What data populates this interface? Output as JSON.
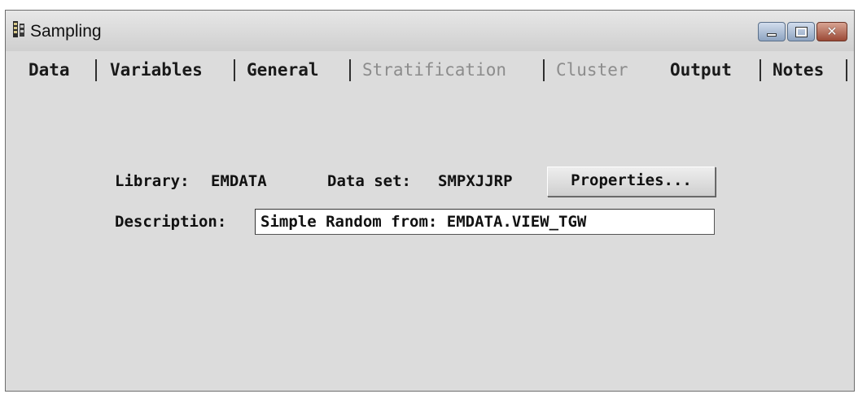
{
  "window": {
    "title": "Sampling"
  },
  "tabs": [
    {
      "label": "Data",
      "enabled": true
    },
    {
      "label": "Variables",
      "enabled": true
    },
    {
      "label": "General",
      "enabled": true
    },
    {
      "label": "Stratification",
      "enabled": false
    },
    {
      "label": "Cluster",
      "enabled": false
    },
    {
      "label": "Output",
      "enabled": true
    },
    {
      "label": "Notes",
      "enabled": true
    }
  ],
  "form": {
    "library_label": "Library:",
    "library_value": "EMDATA",
    "dataset_label": "Data set:",
    "dataset_value": "SMPXJJRP",
    "properties_label": "Properties...",
    "description_label": "Description:",
    "description_value": "Simple Random from: EMDATA.VIEW_TGW"
  },
  "icons": {
    "app": "sampling-app-icon",
    "minimize": "minimize-icon",
    "maximize": "maximize-icon",
    "close": "close-icon"
  }
}
